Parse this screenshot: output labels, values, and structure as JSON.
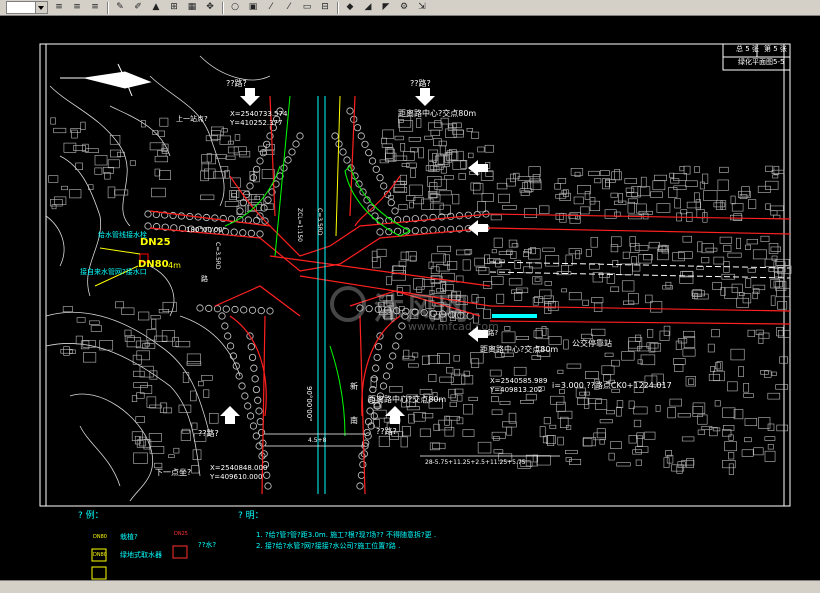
{
  "toolbar": {
    "icons": [
      "layer-icon",
      "linetype-icon",
      "lineweight-icon",
      "pencil-icon",
      "text-edit-icon",
      "north-arrow-icon",
      "plot-icon",
      "grid-icon",
      "pan-icon",
      "circle-icon",
      "save-icon",
      "polyline-icon",
      "arc-icon",
      "rectangle-icon",
      "dimension-icon",
      "region-icon",
      "hatch-icon",
      "view-icon",
      "properties-icon",
      "extend-icon"
    ]
  },
  "title_block": {
    "total_sheets": "总 5 张",
    "sheet_no": "第 5 张",
    "drawing_name": "绿化平面图5-5"
  },
  "labels": {
    "arrow_top_left": "??路?",
    "arrow_top_right": "??路?",
    "coord_top_x": "X=2540733.574",
    "coord_top_y": "Y=410252.377",
    "upper_point": "上一站点?",
    "dist_top": "距离路中心?交点80m",
    "angle_a": "180°00'00\"",
    "dn25": "DN25",
    "dn80": "DN80",
    "dn80_suffix": "4m",
    "pipe_note_1": "给水管线接水栓",
    "pipe_note_2": "接自来水管网?接水口",
    "rd_width_1": "C=3.5RD",
    "rd_width_2": "ZCL=1:150",
    "rd_width_3": "C=3.5RD",
    "road_name": "新",
    "road_name_2": "南",
    "road_name_3": "路",
    "arrow_right_1": "??路?",
    "dist_mid": "距离路中心?交点80m",
    "bus_stop": "公交停靠站",
    "coord_mid_x": "X=2540585.989",
    "coord_mid_y": "Y=409813.202",
    "chainage": "i=3.000  ??路点CK0+1224.017",
    "dist_bottom": "距离路中心?交点80m",
    "arrow_bottom_left": "??路?",
    "arrow_bottom_right": "??路?",
    "lower_point": "下一点坐?",
    "coord_bot_x": "X=2540848.000",
    "coord_bot_y": "Y=409610.000",
    "dim_total": "4.5+8",
    "dim_line": "28-5.75+11.25+2.5+11.25+5.75",
    "angle_v": "90°00'00\""
  },
  "legend": {
    "title": "? 例：",
    "item1": "栽植?",
    "item2": "绿地式取水器",
    "item3": "??水?",
    "item3_code": "DN25",
    "sym1": "DN80",
    "sym2": "DN80"
  },
  "notes": {
    "title": "? 明：",
    "line1": "1. ?给?管?管?距3.0m. 施工?根?现?场?? 不得随意拆?更 .",
    "line2": "2. 接?给?水管?网?接接?水公司?施工位置?路 ."
  },
  "watermark": {
    "cn": "沐风网",
    "en": "www.mfcad.com"
  },
  "colors": {
    "background": "#000000",
    "road": "#ff0000",
    "road_center": "#00ffff",
    "green": "#00ff00",
    "trees": "#c8c8c8",
    "frame": "#ffffff"
  }
}
